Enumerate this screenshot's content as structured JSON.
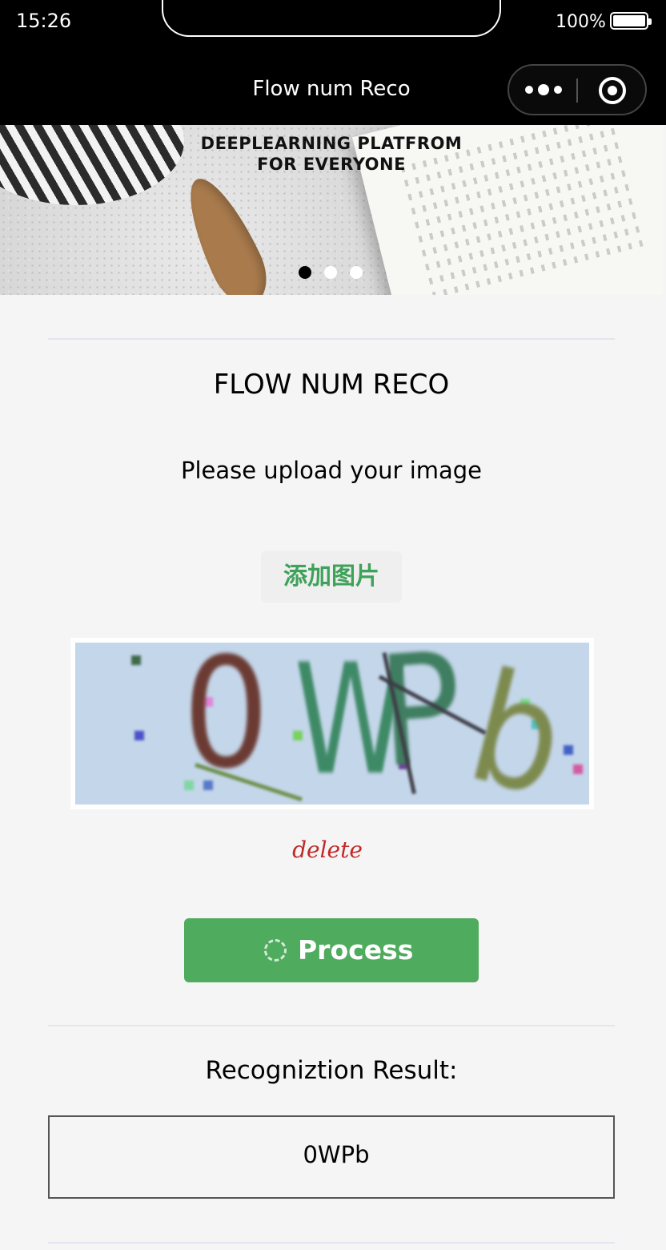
{
  "status_bar": {
    "time": "15:26",
    "battery": "100%"
  },
  "nav": {
    "title": "Flow num Reco"
  },
  "banner": {
    "caption": "DEEPLEARNING PLATFROM FOR EVERYONE",
    "slides": 3,
    "active_slide": 1
  },
  "main": {
    "title": "FLOW NUM RECO",
    "prompt": "Please upload your image",
    "add_image_label": "添加图片",
    "captcha": {
      "text": "0WPb",
      "colors": [
        "#6b3b33",
        "#3e8a66",
        "#3f7e60",
        "#7d8a4e"
      ]
    },
    "delete_label": "delete",
    "process_label": "Process"
  },
  "result": {
    "heading": "Recogniztion Result:",
    "value": "0WPb"
  },
  "colors": {
    "accent_green": "#4fab5e",
    "add_text_green": "#3fa25a",
    "delete_red": "#c02a2a",
    "nav_bg": "#000000"
  }
}
